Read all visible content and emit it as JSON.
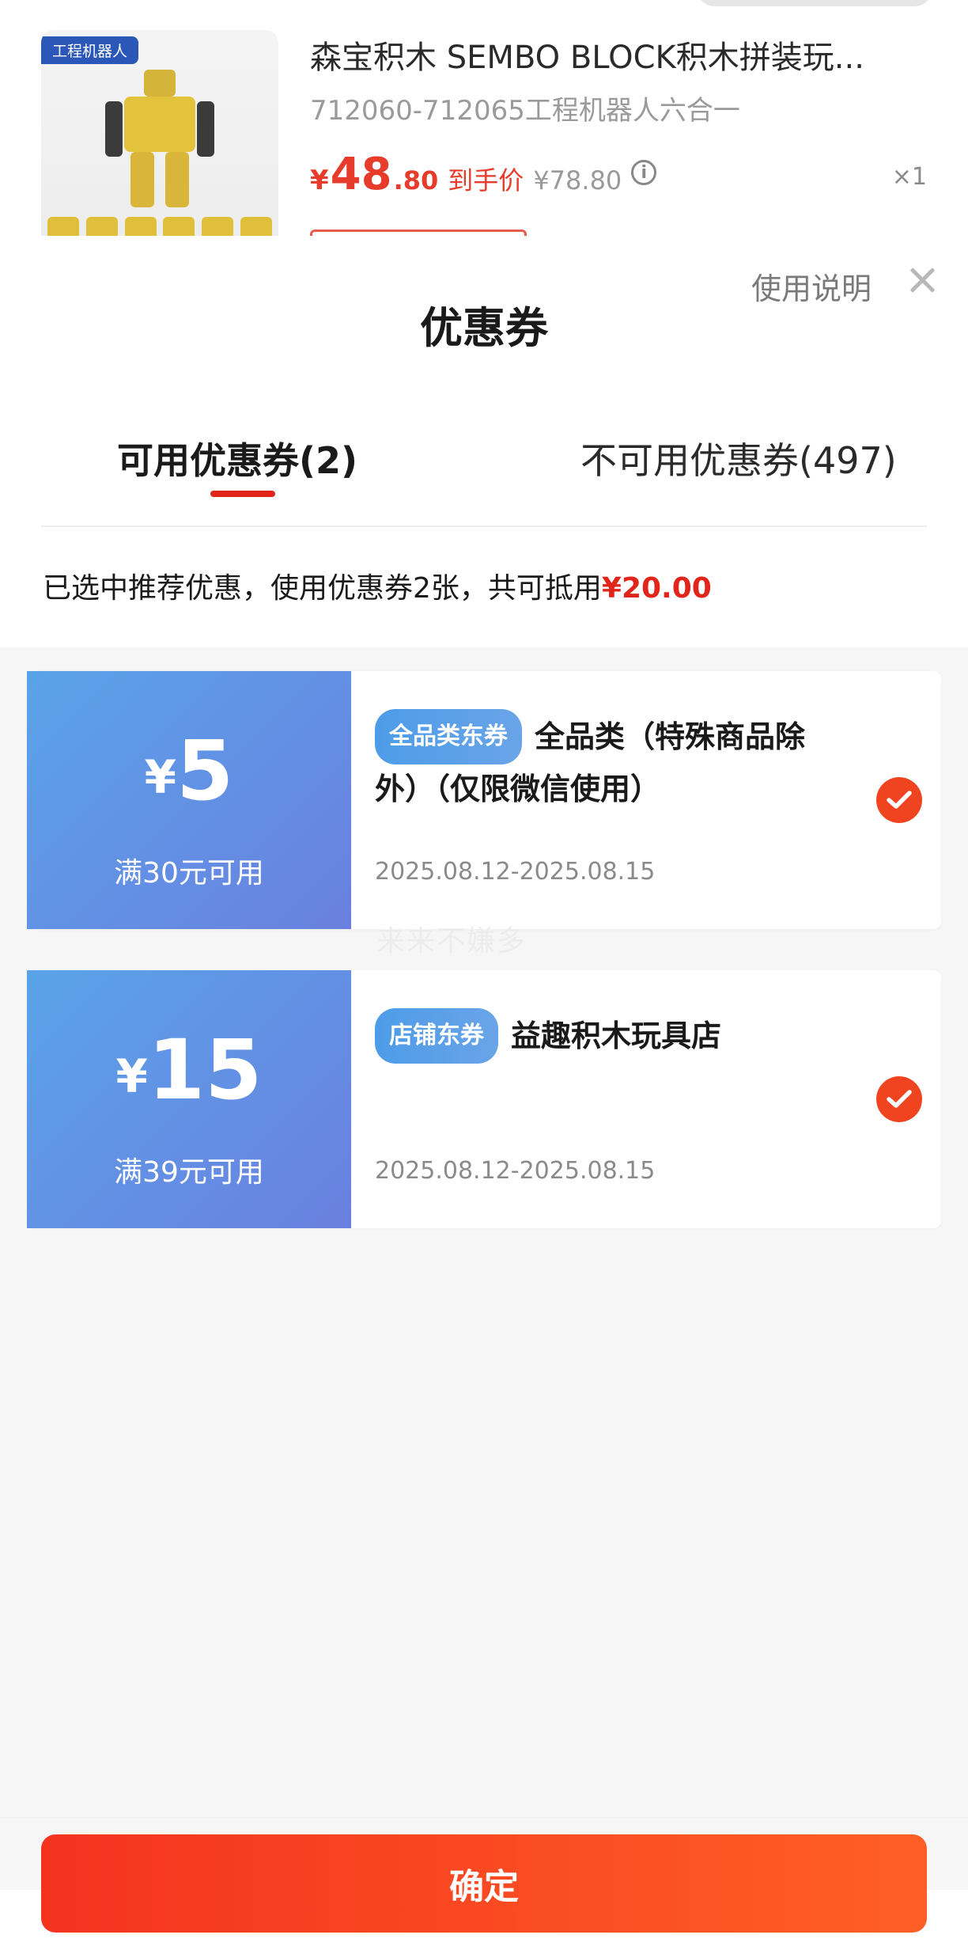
{
  "product": {
    "thumb_tag": "工程机器人",
    "title": "森宝积木 SEMBO BLOCK积木拼装玩...",
    "sku": "712060-712065工程机器人六合一",
    "price_currency": "¥",
    "price_int": "48",
    "price_dec": ".80",
    "price_label": "到手价",
    "price_orig": "¥78.80",
    "qty": "×1"
  },
  "sheet": {
    "title": "优惠券",
    "help_link": "使用说明",
    "tabs": [
      {
        "label": "可用优惠券(2)",
        "active": true
      },
      {
        "label": "不可用优惠券(497)",
        "active": false
      }
    ],
    "summary_prefix": "已选中推荐优惠，使用优惠券2张，共可抵用",
    "summary_amount": "¥20.00"
  },
  "coupons": [
    {
      "currency": "¥",
      "amount": "5",
      "condition": "满30元可用",
      "badge": "全品类东券",
      "desc": "全品类（特殊商品除外）（仅限微信使用）",
      "date": "2025.08.12-2025.08.15",
      "selected": true
    },
    {
      "currency": "¥",
      "amount": "15",
      "condition": "满39元可用",
      "badge": "店铺东券",
      "desc": "益趣积木玩具店",
      "date": "2025.08.12-2025.08.15",
      "selected": true
    }
  ],
  "watermark": "来来不嫌多",
  "confirm_label": "确定",
  "colors": {
    "accent_red": "#e1251b",
    "coupon_blue_start": "#5aa3e8",
    "coupon_blue_end": "#6a80e0",
    "check_orange": "#f0431f",
    "button_start": "#f4331f",
    "button_end": "#ff5f25"
  },
  "icons": {
    "close": "close-icon",
    "info": "info-icon",
    "check": "check-circle-icon"
  }
}
